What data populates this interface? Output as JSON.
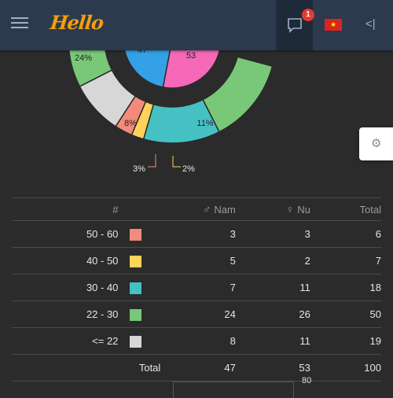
{
  "header": {
    "logo_text": "Hello",
    "message_badge": "1",
    "icons": [
      "menu-icon",
      "chat-icon",
      "vietnam-flag-icon",
      "collapse-icon"
    ]
  },
  "settings": {
    "icon": "gear-icon"
  },
  "chart_data": {
    "type": "pie",
    "inner_ring": {
      "labels": [
        "Nam",
        "Nu"
      ],
      "values": [
        47,
        53
      ],
      "colors": [
        "#34a0e6",
        "#f569b8"
      ]
    },
    "outer_ring": {
      "labels": [
        "50 - 60",
        "40 - 50",
        "30 - 40",
        "22 - 30",
        "<= 22"
      ],
      "percent_labels": [
        "3%",
        "2%",
        "11%",
        "24%",
        "8%"
      ],
      "colors": [
        "#f28b7c",
        "#ffd25a",
        "#45c1c4",
        "#78c877",
        "#d7d7d7"
      ]
    }
  },
  "table": {
    "headers": {
      "group": "#",
      "nam": "Nam",
      "nu": "Nu",
      "total": "Total",
      "male_symbol": "♂",
      "female_symbol": "♀"
    },
    "rows": [
      {
        "label": "50 - 60",
        "color": "#f28b7c",
        "nam": "3",
        "nu": "3",
        "total": "6"
      },
      {
        "label": "40 - 50",
        "color": "#ffd25a",
        "nam": "5",
        "nu": "2",
        "total": "7"
      },
      {
        "label": "30 - 40",
        "color": "#45c1c4",
        "nam": "7",
        "nu": "11",
        "total": "18"
      },
      {
        "label": "22 - 30",
        "color": "#78c877",
        "nam": "24",
        "nu": "26",
        "total": "50"
      },
      {
        "label": "<= 22",
        "color": "#d7d7d7",
        "nam": "8",
        "nu": "11",
        "total": "19"
      }
    ],
    "total_row": {
      "label": "Total",
      "nam": "47",
      "nu": "53",
      "total": "100"
    }
  },
  "bottom_chart": {
    "axis_label": "80"
  }
}
